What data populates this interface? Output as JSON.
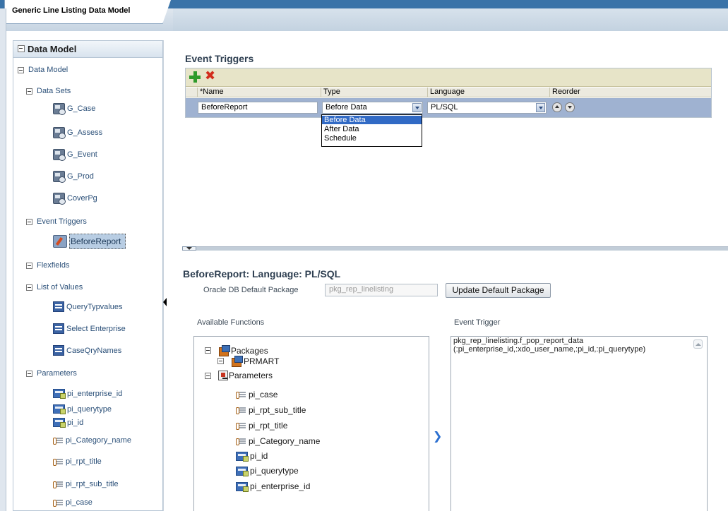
{
  "header": {
    "tab_title": "Generic Line Listing Data Model"
  },
  "left_panel": {
    "title": "Data Model",
    "root": "Data Model",
    "data_sets_label": "Data Sets",
    "data_sets": [
      "G_Case",
      "G_Assess",
      "G_Event",
      "G_Prod",
      "CoverPg"
    ],
    "event_triggers_label": "Event Triggers",
    "event_triggers": [
      "BeforeReport"
    ],
    "flexfields_label": "Flexfields",
    "lov_label": "List of Values",
    "lovs": [
      "QueryTypvalues",
      "Select Enterprise",
      "CaseQryNames"
    ],
    "parameters_label": "Parameters",
    "parameters": [
      "pi_enterprise_id",
      "pi_querytype",
      "pi_id",
      "pi_Category_name",
      "pi_rpt_title",
      "pi_rpt_sub_title",
      "pi_case"
    ]
  },
  "event_triggers": {
    "title": "Event Triggers",
    "columns": {
      "name": "*Name",
      "type": "Type",
      "language": "Language",
      "reorder": "Reorder"
    },
    "row": {
      "name": "BeforeReport",
      "type": "Before Data",
      "language": "PL/SQL"
    },
    "type_options": [
      "Before Data",
      "After Data",
      "Schedule"
    ],
    "type_highlighted": "Before Data"
  },
  "detail": {
    "title": "BeforeReport: Language: PL/SQL",
    "package_label": "Oracle DB Default Package",
    "package_value": "pkg_rep_linelisting",
    "update_button": "Update Default Package",
    "available_functions_label": "Available Functions",
    "event_trigger_label": "Event Trigger",
    "tree": {
      "packages": "Packages",
      "prmart": "PRMART",
      "parameters": "Parameters",
      "items": [
        "pi_case",
        "pi_rpt_sub_title",
        "pi_rpt_title",
        "pi_Category_name",
        "pi_id",
        "pi_querytype",
        "pi_enterprise_id"
      ]
    },
    "trigger_text": "pkg_rep_linelisting.f_pop_report_data\n(:pi_enterprise_id,:xdo_user_name,:pi_id,:pi_querytype)"
  }
}
